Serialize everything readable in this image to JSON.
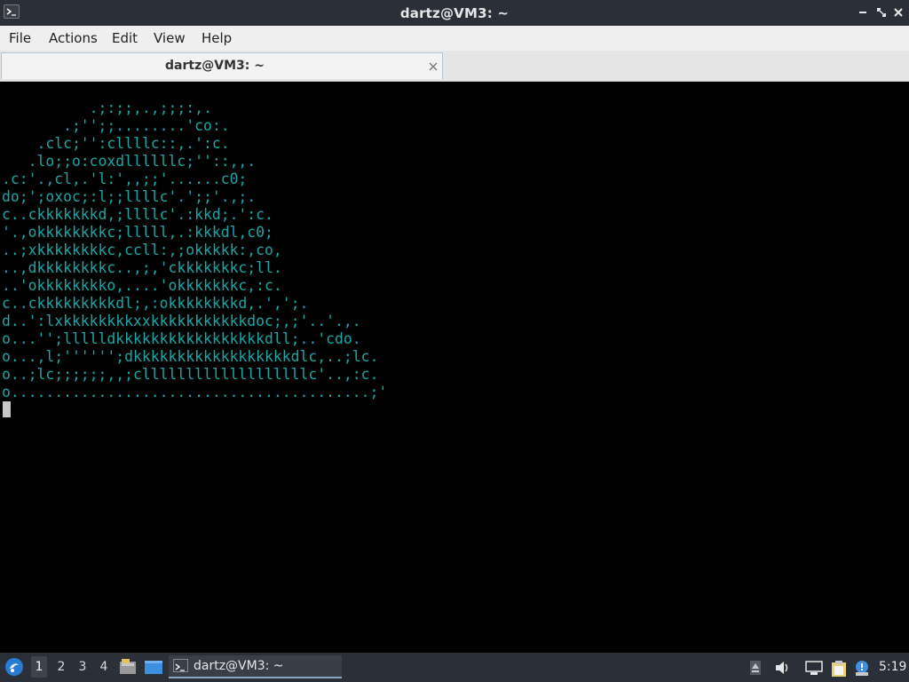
{
  "window": {
    "title": "dartz@VM3: ~"
  },
  "menu": {
    "items": [
      "File",
      "Actions",
      "Edit",
      "View",
      "Help"
    ]
  },
  "tab": {
    "label": "dartz@VM3: ~"
  },
  "terminal": {
    "color": "#1aa6a6",
    "lines": [
      "",
      "          .;:;;,.,;;;:,.",
      "       .;'';;........'co:.",
      "    .clc;'':cllllc::,.':c.",
      "   .lo;;o:coxdllllllc;''::,,.",
      ".c:'.,cl,.'l:',,;;'......c0;",
      "do;';oxoc;:l;;llllc'.';;'.,;.",
      "c..ckkkkkkkd,;llllc'.:kkd;.':c.",
      "'.,okkkkkkkkc;lllll,.:kkkdl,c0;",
      "..;xkkkkkkkkc,ccll:,;okkkkk:,co,",
      "..,dkkkkkkkkc..,;,'ckkkkkkkc;ll.",
      "..'okkkkkkkko,....'okkkkkkkc,:c.",
      "c..ckkkkkkkkkdl;,:okkkkkkkkd,.',';.",
      "d..':lxkkkkkkkkxxkkkkkkkkkkkdoc;,;'..'.,.",
      "o...'';llllldkkkkkkkkkkkkkkkkkdll;..'cdo.",
      "o...,l;'''''';dkkkkkkkkkkkkkkkkkkdlc,..;lc.",
      "o..;lc;;;;;;,,;clllllllllllllllllllc'..,:c.",
      "o.........................................;'"
    ]
  },
  "taskbar": {
    "workspaces": [
      "1",
      "2",
      "3",
      "4"
    ],
    "active_workspace": "1",
    "task_label": "dartz@VM3: ~",
    "clock": "5:19"
  }
}
